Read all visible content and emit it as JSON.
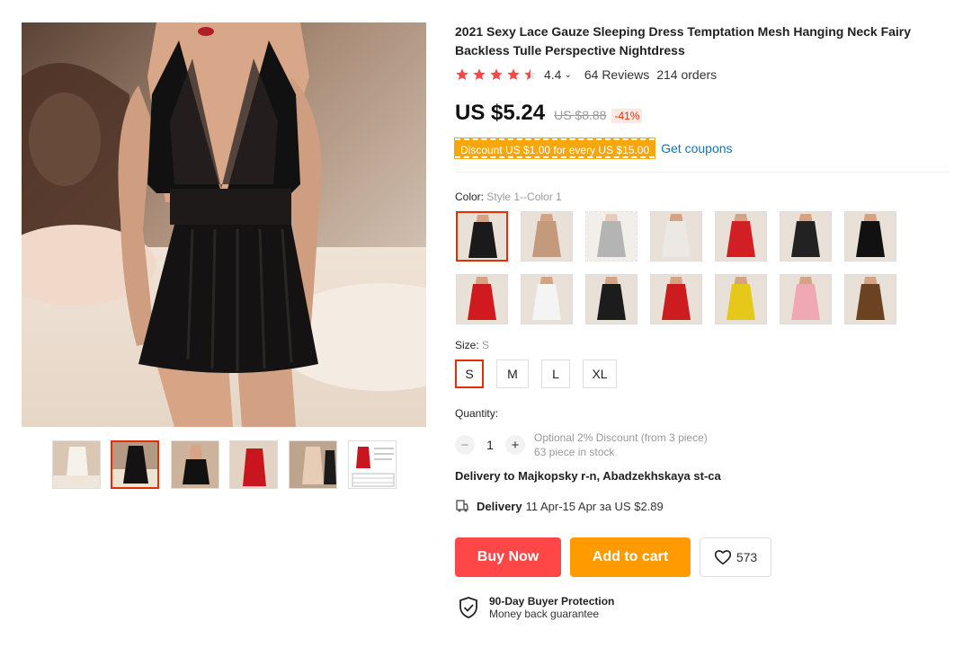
{
  "product": {
    "title": "2021 Sexy Lace Gauze Sleeping Dress Temptation Mesh Hanging Neck Fairy Backless Tulle Perspective Nightdress",
    "rating": "4.4",
    "rating_stars": 4.5,
    "reviews": "64 Reviews",
    "orders": "214 orders",
    "price": "US $5.24",
    "old_price": "US $8.88",
    "discount": "-41%",
    "coupon_text": "Discount US $1.00 for every US $15.00",
    "coupon_link": "Get coupons"
  },
  "gallery": {
    "main_image_icon": "product-photo-black-lace-nightdress",
    "thumbnails": [
      {
        "icon": "thumb-white-dress",
        "active": false
      },
      {
        "icon": "thumb-black-dress",
        "active": true
      },
      {
        "icon": "thumb-black-back",
        "active": false
      },
      {
        "icon": "thumb-red-dress",
        "active": false
      },
      {
        "icon": "thumb-beige-dress",
        "active": false
      },
      {
        "icon": "thumb-size-chart",
        "active": false
      }
    ]
  },
  "color": {
    "label": "Color:",
    "selected": "Style 1--Color 1",
    "swatches": [
      {
        "icon": "swatch-black",
        "color": "#1a1a1a",
        "state": "active"
      },
      {
        "icon": "swatch-nude",
        "color": "#c49a7c",
        "state": "normal"
      },
      {
        "icon": "swatch-grey",
        "color": "#777777",
        "state": "disabled"
      },
      {
        "icon": "swatch-white",
        "color": "#ece9e4",
        "state": "normal"
      },
      {
        "icon": "swatch-red",
        "color": "#d21f26",
        "state": "normal"
      },
      {
        "icon": "swatch-black-2",
        "color": "#222222",
        "state": "normal"
      },
      {
        "icon": "swatch-black-3",
        "color": "#111111",
        "state": "normal"
      },
      {
        "icon": "swatch-red-2",
        "color": "#d01a1f",
        "state": "normal"
      },
      {
        "icon": "swatch-white-2",
        "color": "#f4f4f4",
        "state": "normal"
      },
      {
        "icon": "swatch-black-4",
        "color": "#1c1c1c",
        "state": "normal"
      },
      {
        "icon": "swatch-red-3",
        "color": "#cc1c20",
        "state": "normal"
      },
      {
        "icon": "swatch-yellow",
        "color": "#e6c81a",
        "state": "normal"
      },
      {
        "icon": "swatch-pink",
        "color": "#f0a9b4",
        "state": "normal"
      },
      {
        "icon": "swatch-leopard",
        "color": "#6b4322",
        "state": "normal"
      }
    ]
  },
  "size": {
    "label": "Size:",
    "selected": "S",
    "options": [
      "S",
      "M",
      "L",
      "XL"
    ]
  },
  "quantity": {
    "label": "Quantity:",
    "minus": "−",
    "plus": "+",
    "value": "1",
    "optional_discount": "Optional 2% Discount (from 3 piece)",
    "stock": "63 piece in stock"
  },
  "delivery": {
    "to": "Delivery to Majkopsky r-n, Abadzekhskaya st-ca",
    "label": "Delivery",
    "dates": "11 Apr-15 Apr за US $2.89"
  },
  "actions": {
    "buy_now": "Buy Now",
    "add_to_cart": "Add to cart",
    "wishlist_count": "573"
  },
  "protection": {
    "title": "90-Day Buyer Protection",
    "subtitle": "Money back guarantee"
  },
  "colors": {
    "accent_red": "#ff4747",
    "accent_orange": "#ff9a00",
    "star": "#ff4747",
    "link": "#0e73c2"
  }
}
